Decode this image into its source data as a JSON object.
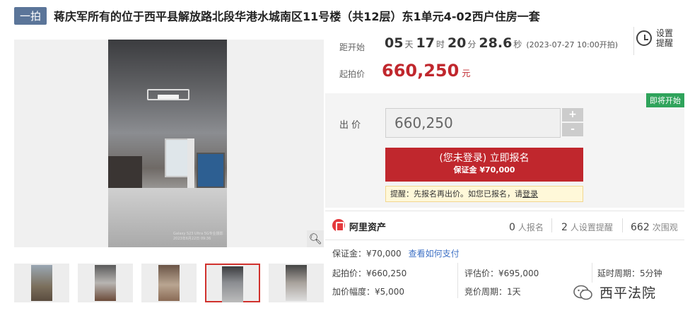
{
  "header": {
    "badge": "一拍",
    "title": "蒋庆军所有的位于西平县解放路北段华港水城南区11号楼（共12层）东1单元4-02西户住房一套"
  },
  "gallery": {
    "watermark": "Galaxy S23 Ultra 5G专业摄影\n2023年6月22日 09:36",
    "zoom_icon": "magnifier-icon",
    "active_thumb": 4,
    "thumb_count": 5
  },
  "countdown": {
    "label": "距开始",
    "days": "05",
    "days_unit": "天",
    "hours": "17",
    "hours_unit": "时",
    "minutes": "20",
    "minutes_unit": "分",
    "seconds": "28.6",
    "seconds_unit": "秒",
    "start_time": "(2023-07-27 10:00开拍)"
  },
  "reminder": {
    "label": "设置提醒",
    "icon": "alarm-clock-icon"
  },
  "start_price": {
    "label": "起拍价",
    "value": "660,250",
    "unit": "元"
  },
  "bid": {
    "status_tag": "即将开始",
    "label": "出 价",
    "input_value": "660,250",
    "plus": "+",
    "minus": "-",
    "signup_main": "(您未登录) 立即报名",
    "signup_sub": "保证金 ¥70,000",
    "notice_prefix": "提醒：先报名再出价。如您已报名，请",
    "notice_link": "登录"
  },
  "stats": {
    "platform": "阿里资产",
    "signups": {
      "num": "0",
      "label": "人报名"
    },
    "reminders": {
      "num": "2",
      "label": "人设置提醒"
    },
    "views": {
      "num": "662",
      "label": "次围观"
    }
  },
  "info": {
    "deposit": "保证金：¥70,000",
    "payment_link": "查看如何支付",
    "start_price": "起拍价：¥660,250",
    "appraisal": "评估价：¥695,000",
    "delay": "延时周期：5分钟",
    "increment": "加价幅度：¥5,000",
    "bid_cycle": "竞价周期：1天"
  },
  "watermark": {
    "text": "西平法院",
    "icon": "wechat-icon"
  },
  "colors": {
    "accent_red": "#c0272d",
    "badge_blue": "#5b7599",
    "status_green": "#2fa35b",
    "link_blue": "#3f71c5"
  }
}
